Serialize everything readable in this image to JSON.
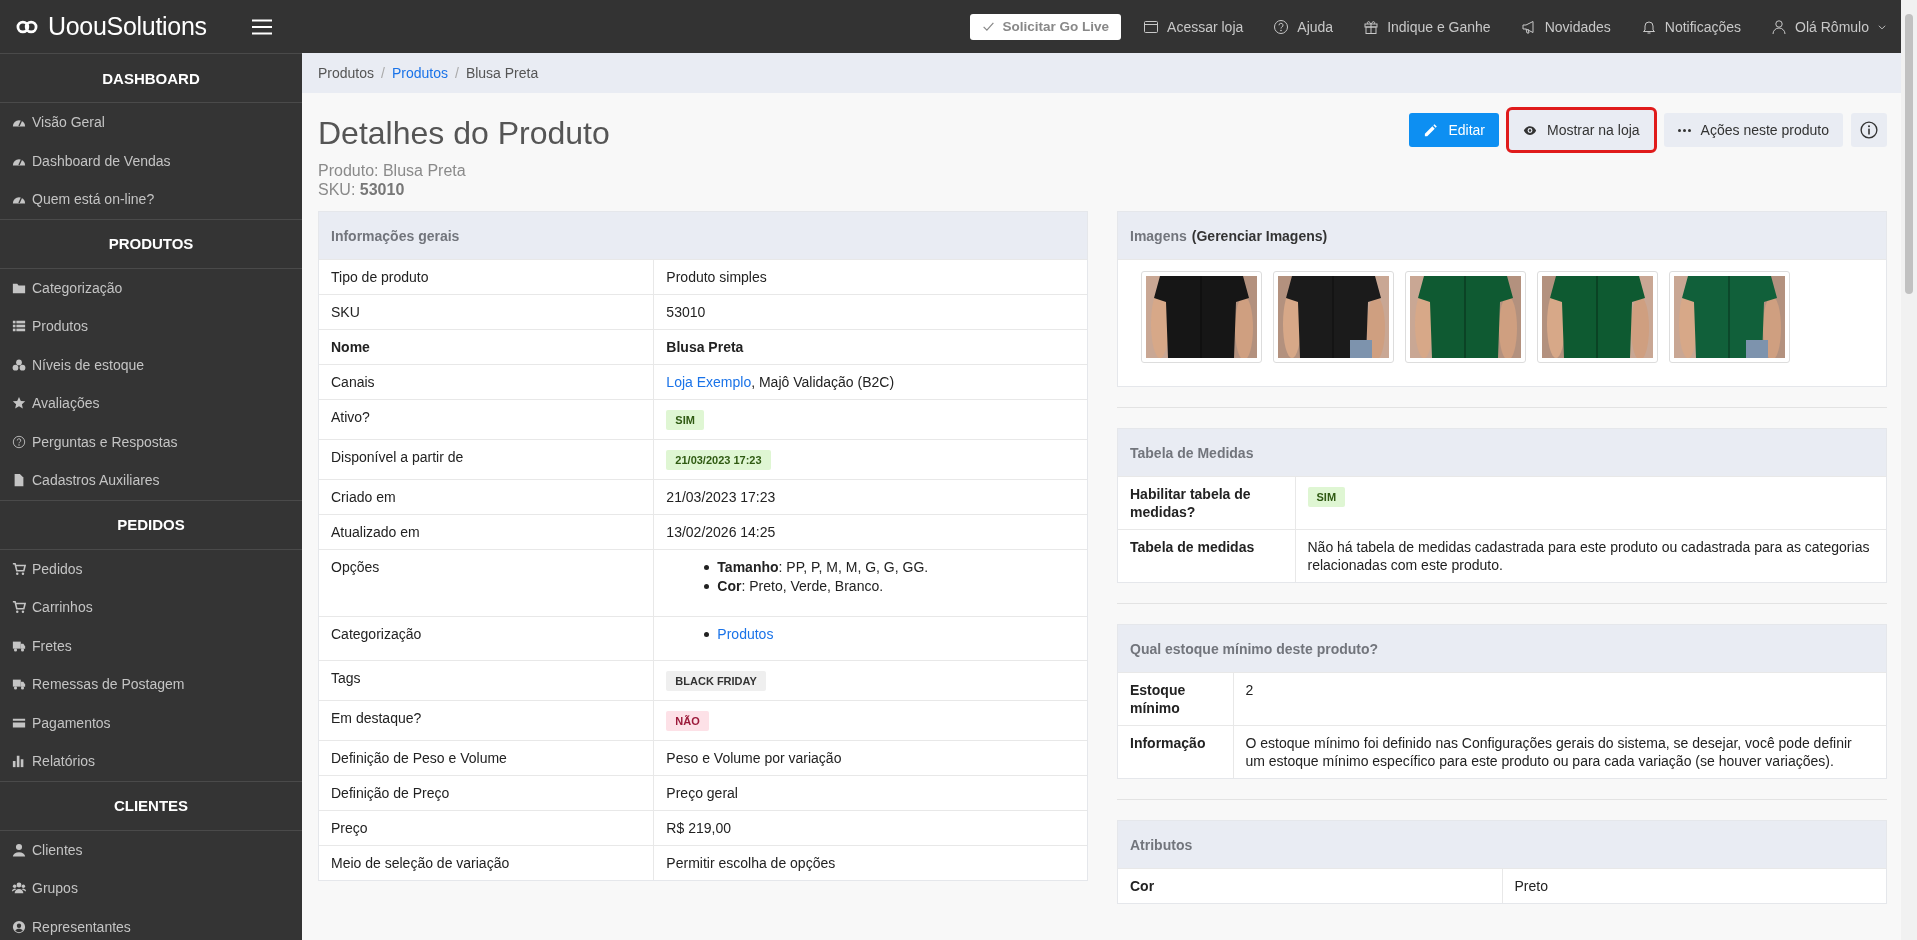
{
  "topbar": {
    "brand": "**Uoou**Solutions",
    "go_live": "Solicitar Go Live",
    "links": [
      "Acessar loja",
      "Ajuda",
      "Indique e Ganhe",
      "Novidades",
      "Notificações"
    ],
    "user": "Olá Rômulo"
  },
  "sidebar": {
    "sections": [
      {
        "title": "DASHBOARD",
        "items": [
          "Visão Geral",
          "Dashboard de Vendas",
          "Quem está on-line?"
        ]
      },
      {
        "title": "PRODUTOS",
        "items": [
          "Categorização",
          "Produtos",
          "Níveis de estoque",
          "Avaliações",
          "Perguntas e Respostas",
          "Cadastros Auxiliares"
        ]
      },
      {
        "title": "PEDIDOS",
        "items": [
          "Pedidos",
          "Carrinhos",
          "Fretes",
          "Remessas de Postagem",
          "Pagamentos",
          "Relatórios"
        ]
      },
      {
        "title": "CLIENTES",
        "items": [
          "Clientes",
          "Grupos",
          "Representantes"
        ]
      }
    ]
  },
  "breadcrumb": [
    {
      "label": "Produtos",
      "link": false
    },
    {
      "separator": "/",
      "label": "Produtos",
      "link": true
    },
    {
      "separator": "/",
      "label": "Blusa Preta",
      "link": false
    }
  ],
  "header": {
    "title": "Detalhes do Produto",
    "subtitle": "Produto: Blusa Preta",
    "sku": "SKU: **53010**",
    "actions": [
      {
        "kind": "primary",
        "label": "Editar",
        "highlighted": false
      },
      {
        "kind": "secondary",
        "label": "Mostrar na loja",
        "highlighted": true
      },
      {
        "kind": "secondary",
        "label": "Ações neste produto",
        "highlighted": false
      },
      {
        "kind": "info",
        "highlighted": false
      }
    ]
  },
  "general_info": {
    "title": "Informações gerais",
    "rows": [
      {
        "label": "Tipo de produto",
        "kind": "text",
        "value": "Produto simples",
        "emphasis": false
      },
      {
        "label": "SKU",
        "kind": "text",
        "value": "53010",
        "emphasis": false
      },
      {
        "label": "Nome",
        "kind": "text",
        "value": "Blusa Preta",
        "emphasis": true
      },
      {
        "label": "Canais",
        "kind": "parts",
        "parts": [
          {
            "text": "Loja Exemplo",
            "link": true
          },
          {
            "text": ", Majô Validação (B2C)",
            "link": false
          }
        ],
        "emphasis": false
      },
      {
        "label": "Ativo?",
        "kind": "badge",
        "value": "SIM",
        "color": "#dff6d3",
        "emphasis": false
      },
      {
        "label": "Disponível a partir de",
        "kind": "badge",
        "value": "21/03/2023 17:23",
        "color": "#dff6d3",
        "emphasis": false
      },
      {
        "label": "Criado em",
        "kind": "text",
        "value": "21/03/2023 17:23",
        "emphasis": false
      },
      {
        "label": "Atualizado em",
        "kind": "text",
        "value": "13/02/2026 14:25",
        "emphasis": false
      },
      {
        "label": "Opções",
        "kind": "list",
        "items": [
          "**Tamanho**: PP, P, M, M, G, G, GG.",
          "**Cor**: Preto, Verde, Branco."
        ],
        "emphasis": false
      },
      {
        "label": "Categorização",
        "kind": "links",
        "items": [
          "Produtos"
        ],
        "emphasis": false
      },
      {
        "label": "Tags",
        "kind": "badge",
        "value": "BLACK FRIDAY",
        "color": "#efefef",
        "emphasis": false
      },
      {
        "label": "Em destaque?",
        "kind": "badge",
        "value": "NÃO",
        "color": "#fde1e7",
        "emphasis": false
      },
      {
        "label": "Definição de Peso e Volume",
        "kind": "text",
        "value": "Peso e Volume por variação",
        "emphasis": false
      },
      {
        "label": "Definição de Preço",
        "kind": "text",
        "value": "Preço geral",
        "emphasis": false
      },
      {
        "label": "Preço",
        "kind": "text",
        "value": "R$ 219,00",
        "emphasis": false
      },
      {
        "label": "Meio de seleção de variação",
        "kind": "text",
        "value": "Permitir escolha de opções",
        "emphasis": false
      }
    ]
  },
  "images_panel": {
    "title": "Imagens",
    "link": "(Gerenciar Imagens)"
  },
  "panels": [
    {
      "title": "Tabela de Medidas",
      "rows": [
        {
          "label": "Habilitar tabela de medidas?",
          "kind": "badge",
          "value": "SIM",
          "color": "#dff6d3"
        },
        {
          "label": "Tabela de medidas",
          "kind": "text",
          "value": "Não há tabela de medidas cadastrada para este produto ou cadastrada para as categorias relacionadas com este produto."
        }
      ]
    },
    {
      "title": "Qual estoque mínimo deste produto?",
      "rows": [
        {
          "label": "Estoque mínimo",
          "kind": "text",
          "value": "2"
        },
        {
          "label": "Informação",
          "kind": "text",
          "value": "O estoque mínimo foi definido nas Configurações gerais do sistema, se desejar, você pode definir um estoque mínimo específico para este produto ou para cada variação (se houver variações)."
        }
      ]
    },
    {
      "title": "Atributos",
      "rows": [
        {
          "label": "Cor",
          "kind": "text",
          "value": "Preto"
        }
      ]
    }
  ]
}
